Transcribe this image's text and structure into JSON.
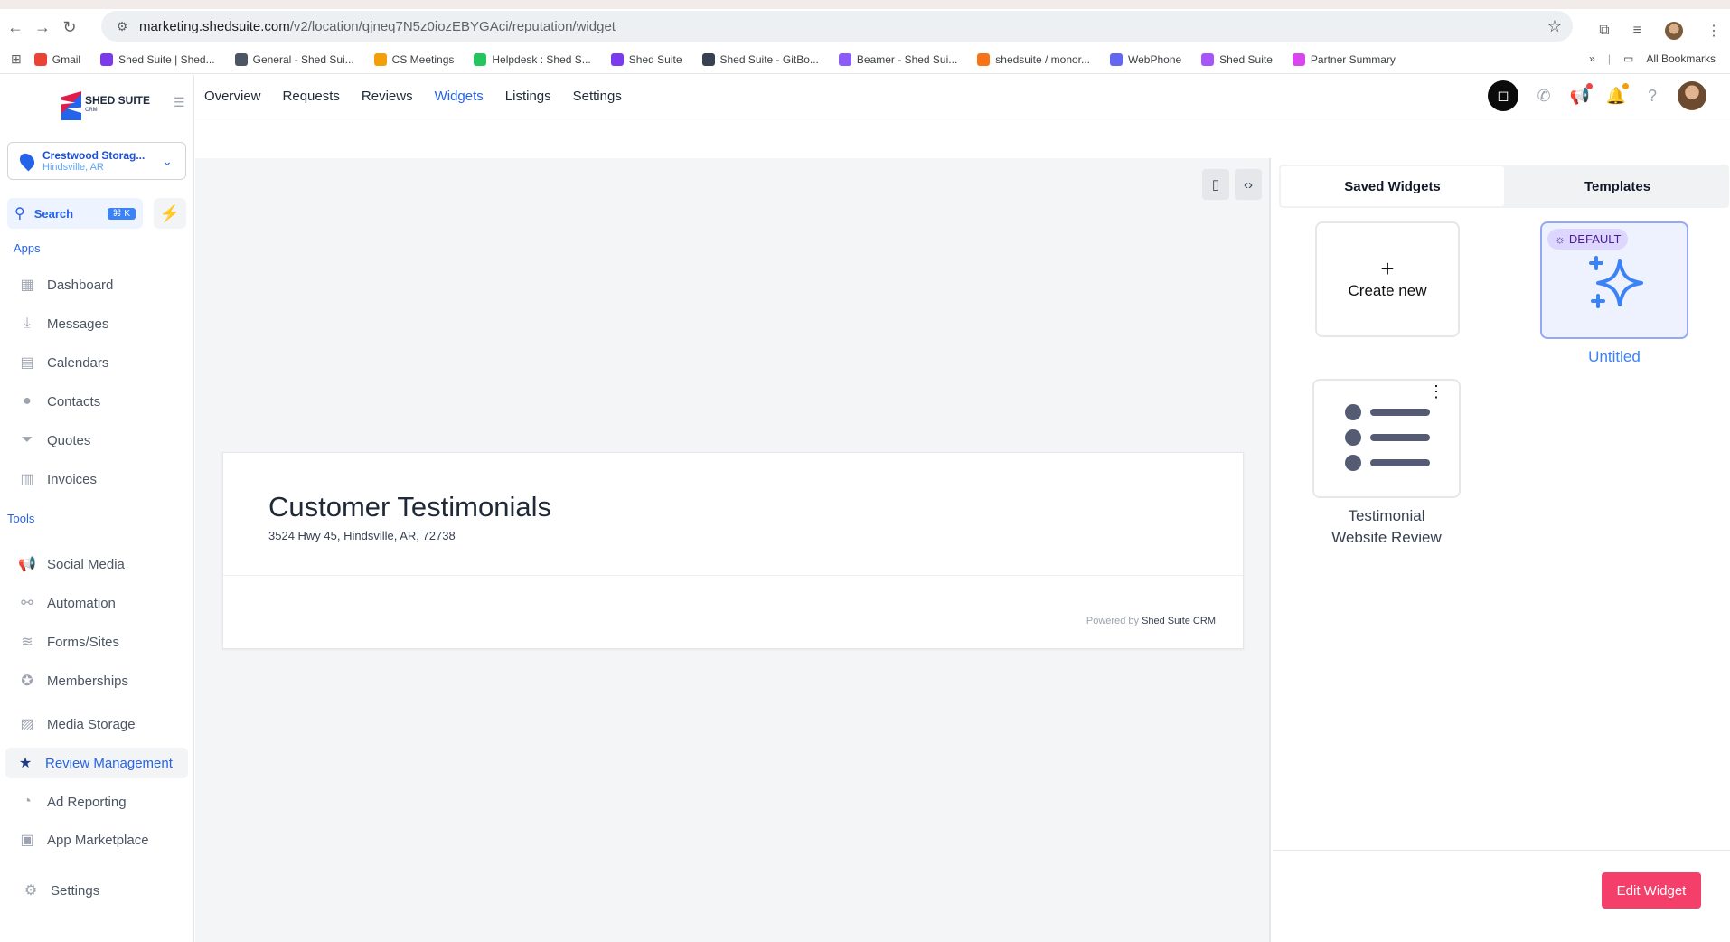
{
  "browser": {
    "url_host": "marketing.shedsuite.com",
    "url_path": "/v2/location/qjneq7N5z0iozEBYGAci/reputation/widget",
    "bookmarks": [
      {
        "label": "Gmail",
        "color": "#ea4335"
      },
      {
        "label": "Shed Suite | Shed...",
        "color": "#7c3aed"
      },
      {
        "label": "General - Shed Sui...",
        "color": "#4b5563"
      },
      {
        "label": "CS Meetings",
        "color": "#f59e0b"
      },
      {
        "label": "Helpdesk : Shed S...",
        "color": "#22c55e"
      },
      {
        "label": "Shed Suite",
        "color": "#7c3aed"
      },
      {
        "label": "Shed Suite - GitBo...",
        "color": "#374151"
      },
      {
        "label": "Beamer - Shed Sui...",
        "color": "#8b5cf6"
      },
      {
        "label": "shedsuite / monor...",
        "color": "#f97316"
      },
      {
        "label": "WebPhone",
        "color": "#6366f1"
      },
      {
        "label": "Shed Suite",
        "color": "#a855f7"
      },
      {
        "label": "Partner Summary",
        "color": "#d946ef"
      }
    ],
    "all_bookmarks": "All Bookmarks"
  },
  "brand": {
    "name": "SHED SUITE",
    "sub": "CRM"
  },
  "location": {
    "name": "Crestwood Storag...",
    "city": "Hindsville, AR"
  },
  "search": {
    "label": "Search",
    "shortcut": "⌘ K"
  },
  "sidebar": {
    "apps_label": "Apps",
    "tools_label": "Tools",
    "apps": [
      {
        "label": "Dashboard",
        "icon": "dashboard-icon"
      },
      {
        "label": "Messages",
        "icon": "messages-icon"
      },
      {
        "label": "Calendars",
        "icon": "calendar-icon"
      },
      {
        "label": "Contacts",
        "icon": "contacts-icon"
      },
      {
        "label": "Quotes",
        "icon": "quotes-icon"
      },
      {
        "label": "Invoices",
        "icon": "invoices-icon"
      }
    ],
    "tools": [
      {
        "label": "Social Media",
        "icon": "megaphone-icon"
      },
      {
        "label": "Automation",
        "icon": "automation-icon"
      },
      {
        "label": "Forms/Sites",
        "icon": "database-icon"
      },
      {
        "label": "Memberships",
        "icon": "award-icon"
      },
      {
        "label": "Media Storage",
        "icon": "image-icon"
      },
      {
        "label": "Review Management",
        "icon": "star-icon"
      },
      {
        "label": "Ad Reporting",
        "icon": "pie-chart-icon"
      },
      {
        "label": "App Marketplace",
        "icon": "briefcase-icon"
      }
    ],
    "settings": "Settings"
  },
  "topnav": {
    "tabs": [
      "Overview",
      "Requests",
      "Reviews",
      "Widgets",
      "Listings",
      "Settings"
    ],
    "active": "Widgets"
  },
  "widget_preview": {
    "title": "Customer Testimonials",
    "address": "3524 Hwy 45, Hindsville, AR, 72738",
    "powered_prefix": "Powered by",
    "powered_brand": "Shed Suite CRM"
  },
  "right_panel": {
    "tabs": [
      "Saved Widgets",
      "Templates"
    ],
    "active_tab": "Saved Widgets",
    "create_new": "Create new",
    "default_badge": "DEFAULT",
    "untitled": "Untitled",
    "testimonial_line1": "Testimonial",
    "testimonial_line2": "Website Review",
    "edit_button": "Edit Widget"
  },
  "colors": {
    "accent": "#2563eb",
    "cta": "#f43f6a",
    "badge": "#ddd6fe"
  }
}
